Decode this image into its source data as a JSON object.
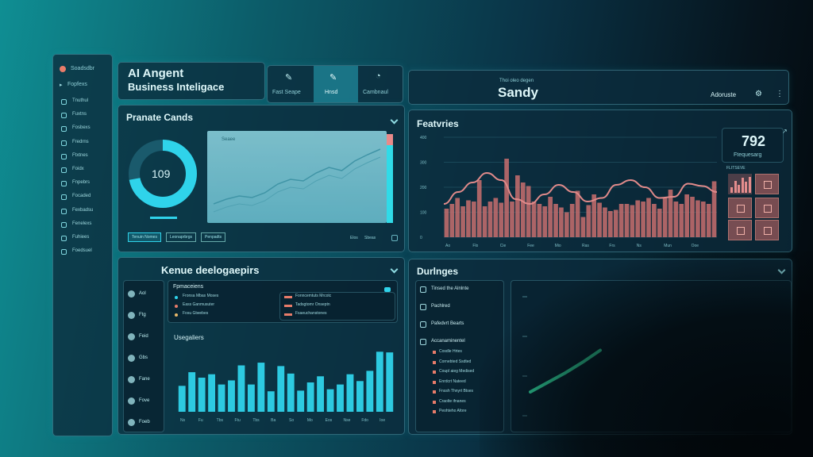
{
  "sidebar": {
    "title": "Soadsdbr",
    "top_item": "Fopfexs",
    "items": [
      "Tnuthul",
      "Fuxtns",
      "Fosbexs",
      "Fredrns",
      "Ftxtnes",
      "Foidx",
      "Fnpebrs",
      "Focaded",
      "Fexbadsu",
      "Fenelexs",
      "Fuhiees",
      "Foedsuel"
    ]
  },
  "header": {
    "title_line1": "AI Angent",
    "title_line2": "Business Inteligace",
    "tabs": [
      {
        "label": "Fast Seape",
        "icon": "edit-icon"
      },
      {
        "label": "Hnsd",
        "icon": "edit-icon"
      },
      {
        "label": "Cambnaul",
        "icon": "user-icon"
      }
    ]
  },
  "user_header": {
    "small_label": "Thoi oleo degen",
    "name": "Sandy",
    "right_label": "Adoruste"
  },
  "card_overview": {
    "title": "Pranate Cands",
    "donut_value": "109",
    "donut_fraction": 0.72,
    "chart_small_label": "Seaee",
    "legend_chips": [
      "Tenuin Nomes",
      "Leonaprbrgs",
      "Penpadts"
    ],
    "right_labels": [
      "Elos",
      "Sbeas"
    ]
  },
  "card_features": {
    "title": "Featvries",
    "kpi_value": "792",
    "kpi_label": "Ftequesarg",
    "kpi_small": "FLITSEVE",
    "y_ticks": [
      "400",
      "300",
      "200",
      "100",
      "0"
    ],
    "x_ticks": [
      "Ao",
      "Flo",
      "Cie",
      "Fee",
      "Mio",
      "Ras",
      "Frs",
      "Ns",
      "Mun",
      "Ooe"
    ]
  },
  "card_devices": {
    "title": "Kenue deelogaepirs",
    "left_items": [
      "Aol",
      "Ftg",
      "Feid",
      "Gbs",
      "Fane",
      "Fove",
      "Foeb"
    ],
    "panel_title": "Fpmaceiens",
    "list_a": [
      "Fronsa Mbas Moses",
      "Eass Ganmusuter",
      "Fosu Gtwebes"
    ],
    "list_b": [
      "Fonncemtuts Mrcotc",
      "Tadsgtomr Onseptn",
      "Fsaeuchanstones"
    ],
    "bars_title": "Usegaliers",
    "x_ticks": [
      "Ns",
      "Fu",
      "Tbs",
      "Ftu",
      "Tbs",
      "Ba",
      "So",
      "Mo",
      "Eos",
      "Nse",
      "Fdo",
      "Ioe"
    ]
  },
  "card_settings": {
    "title": "Durlnges",
    "menu": [
      "Tinsed the Alnlnte",
      "Pachlred",
      "Pafedvrt Bearts",
      "Accanaminentel"
    ],
    "sub_items": [
      "Cosdle Hrtes",
      "Cornebted Ssdted",
      "Coupl aieg Medised",
      "Enrdcrt Nateed",
      "Fnssh Thnyrt Btses",
      "Craolte ifnanes",
      "Peohteho Afore"
    ]
  },
  "chart_data": [
    {
      "type": "line",
      "title": "",
      "series": [
        {
          "values": [
            16,
            22,
            26,
            24,
            30,
            41,
            47,
            45,
            55,
            62,
            58,
            70,
            78,
            85
          ]
        }
      ],
      "ylim": [
        0,
        100
      ]
    },
    {
      "type": "bar",
      "title": "Featvries",
      "y_ticks": [
        "400",
        "300",
        "200",
        "100",
        "0"
      ],
      "values": [
        120,
        140,
        165,
        130,
        155,
        150,
        240,
        130,
        150,
        165,
        145,
        330,
        150,
        260,
        230,
        215,
        150,
        140,
        130,
        170,
        140,
        125,
        105,
        140,
        195,
        85,
        135,
        180,
        145,
        125,
        110,
        115,
        140,
        140,
        135,
        155,
        150,
        165,
        140,
        120,
        165,
        200,
        150,
        140,
        180,
        170,
        155,
        150,
        140,
        235
      ],
      "line_values": [
        140,
        190,
        230,
        270,
        240,
        160,
        140,
        180,
        220,
        190,
        150,
        165,
        220,
        240,
        210,
        165,
        170,
        225,
        215,
        190
      ],
      "ylim": [
        0,
        420
      ]
    },
    {
      "type": "bar",
      "title": "Usegaliers",
      "x_ticks": [
        "Ns",
        "Fu",
        "Tbs",
        "Ftu",
        "Tbs",
        "Ba",
        "So",
        "Mo",
        "Eos",
        "Nse",
        "Fdo",
        "Ioe"
      ],
      "values": [
        38,
        58,
        50,
        55,
        40,
        46,
        68,
        40,
        72,
        30,
        67,
        56,
        31,
        43,
        52,
        33,
        40,
        55,
        45,
        60,
        88,
        87
      ],
      "ylim": [
        0,
        100
      ]
    },
    {
      "type": "line",
      "title": "",
      "series": [
        {
          "values": [
            20,
            28,
            36,
            45,
            55
          ]
        }
      ],
      "ylim": [
        0,
        100
      ]
    }
  ],
  "colors": {
    "accent_cyan": "#2fd3ea",
    "bar_red": "#c96f6f",
    "line_green": "#33e0a6"
  }
}
